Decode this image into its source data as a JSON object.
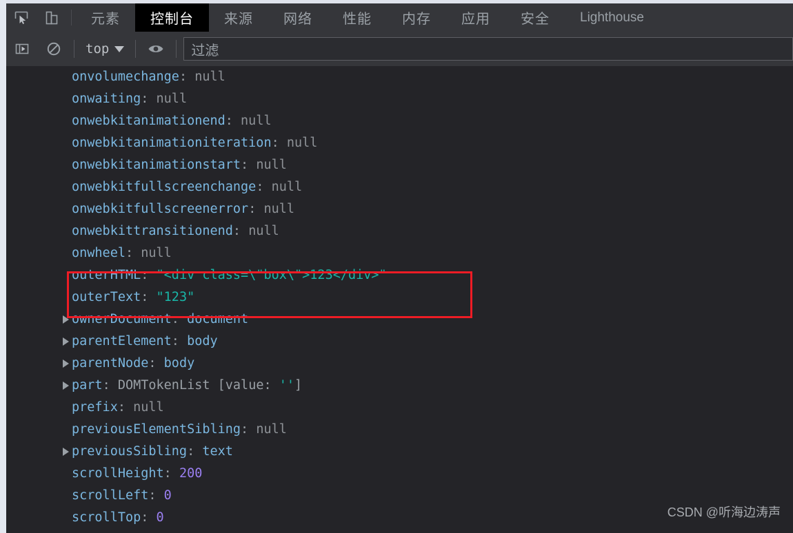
{
  "window": {
    "app": "Chrome DevTools"
  },
  "tabbar": {
    "icons": [
      {
        "name": "inspect-element-icon",
        "glyph": "cursor-box"
      },
      {
        "name": "device-toolbar-icon",
        "glyph": "device"
      }
    ],
    "tabs": [
      {
        "label": "元素",
        "selected": false,
        "latin": false
      },
      {
        "label": "控制台",
        "selected": true,
        "latin": false
      },
      {
        "label": "来源",
        "selected": false,
        "latin": false
      },
      {
        "label": "网络",
        "selected": false,
        "latin": false
      },
      {
        "label": "性能",
        "selected": false,
        "latin": false
      },
      {
        "label": "内存",
        "selected": false,
        "latin": false
      },
      {
        "label": "应用",
        "selected": false,
        "latin": false
      },
      {
        "label": "安全",
        "selected": false,
        "latin": false
      },
      {
        "label": "Lighthouse",
        "selected": false,
        "latin": true
      }
    ]
  },
  "filterbar": {
    "sidebar_toggle_icon": "console-sidebar-icon",
    "clear_icon": "clear-console-icon",
    "context_label": "top",
    "eye_icon": "live-expression-icon",
    "filter_placeholder": "过滤"
  },
  "console": {
    "rows": [
      {
        "expandable": false,
        "key": "onvolumechange",
        "value": "null",
        "kind": "null"
      },
      {
        "expandable": false,
        "key": "onwaiting",
        "value": "null",
        "kind": "null"
      },
      {
        "expandable": false,
        "key": "onwebkitanimationend",
        "value": "null",
        "kind": "null"
      },
      {
        "expandable": false,
        "key": "onwebkitanimationiteration",
        "value": "null",
        "kind": "null"
      },
      {
        "expandable": false,
        "key": "onwebkitanimationstart",
        "value": "null",
        "kind": "null"
      },
      {
        "expandable": false,
        "key": "onwebkitfullscreenchange",
        "value": "null",
        "kind": "null"
      },
      {
        "expandable": false,
        "key": "onwebkitfullscreenerror",
        "value": "null",
        "kind": "null"
      },
      {
        "expandable": false,
        "key": "onwebkittransitionend",
        "value": "null",
        "kind": "null"
      },
      {
        "expandable": false,
        "key": "onwheel",
        "value": "null",
        "kind": "null"
      },
      {
        "expandable": false,
        "key": "outerHTML",
        "value": "\"<div class=\\\"box\\\">123</div>\"",
        "kind": "string"
      },
      {
        "expandable": false,
        "key": "outerText",
        "value": "\"123\"",
        "kind": "string"
      },
      {
        "expandable": true,
        "key": "ownerDocument",
        "value": "document",
        "kind": "object"
      },
      {
        "expandable": true,
        "key": "parentElement",
        "value": "body",
        "kind": "object"
      },
      {
        "expandable": true,
        "key": "parentNode",
        "value": "body",
        "kind": "object"
      },
      {
        "expandable": true,
        "key": "part",
        "value": "DOMTokenList [value: '']",
        "kind": "domtokenlist"
      },
      {
        "expandable": false,
        "key": "prefix",
        "value": "null",
        "kind": "null"
      },
      {
        "expandable": false,
        "key": "previousElementSibling",
        "value": "null",
        "kind": "null"
      },
      {
        "expandable": true,
        "key": "previousSibling",
        "value": "text",
        "kind": "object"
      },
      {
        "expandable": false,
        "key": "scrollHeight",
        "value": "200",
        "kind": "number"
      },
      {
        "expandable": false,
        "key": "scrollLeft",
        "value": "0",
        "kind": "number"
      },
      {
        "expandable": false,
        "key": "scrollTop",
        "value": "0",
        "kind": "number"
      }
    ],
    "highlight": {
      "name": "outerhtml-outertext-highlight",
      "color": "#ee1c25",
      "rows": [
        "outerHTML",
        "outerText"
      ]
    }
  },
  "watermark": {
    "text": "CSDN @听海边涛声"
  }
}
